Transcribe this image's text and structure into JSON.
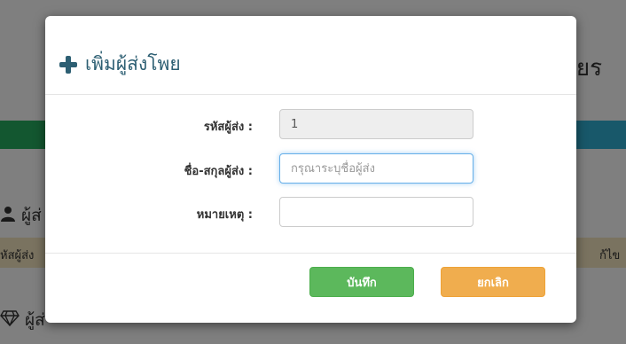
{
  "background": {
    "page_title": "จ่ายร",
    "section_title": "ผู้ส่",
    "table_headers": [
      "หัสผู้ส่ง",
      "ก้ไข"
    ],
    "section2_title": "ผู้ส่"
  },
  "modal": {
    "title": "เพิ่มผู้ส่งโพย",
    "fields": [
      {
        "label": "รหัสผู้ส่ง :",
        "value": "1",
        "placeholder": ""
      },
      {
        "label": "ชื่อ-สกุลผู้ส่ง :",
        "value": "",
        "placeholder": "กรุณาระบุชื่อผู้ส่ง"
      },
      {
        "label": "หมายเหตุ :",
        "value": "",
        "placeholder": ""
      }
    ],
    "buttons": {
      "save": "บันทึก",
      "cancel": "ยกเลิก"
    }
  },
  "colors": {
    "title": "#2d5f73",
    "save": "#5cb85c",
    "cancel": "#f0ad4e",
    "focus": "#66afe9"
  }
}
